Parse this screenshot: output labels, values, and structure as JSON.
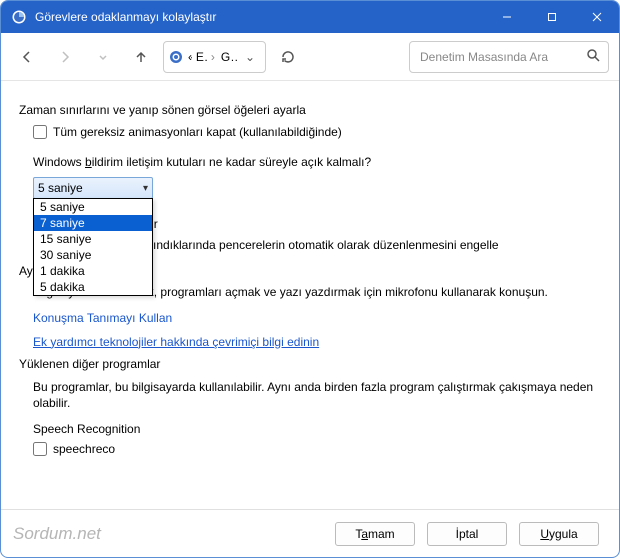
{
  "titlebar": {
    "title": "Görevlere odaklanmayı kolaylaştır"
  },
  "breadcrumb": {
    "root_label": "«",
    "crumb1": "Erişi...",
    "crumb2": "Görevle..."
  },
  "search": {
    "placeholder": "Denetim Masasında Ara"
  },
  "section1": {
    "heading": "Zaman sınırlarını ve yanıp sönen görsel öğeleri ayarla",
    "checkbox_label": "Tüm gereksiz animasyonları kapat (kullanılabildiğinde)",
    "sub_label_prefix": "Windows ",
    "sub_label_hot": "b",
    "sub_label_rest": "ildirim iletişim kutuları ne kadar süreyle açık kalmalı?",
    "selected": "5 saniye",
    "options": [
      "5 saniye",
      "7 saniye",
      "15 saniye",
      "30 saniye",
      "1 dakika",
      "5 dakika"
    ],
    "highlight_index": 1
  },
  "section2": {
    "heading_suffix": "laylaştır",
    "text_suffix": "ındıklarında pencerelerin otomatik olarak düzenlenmesini engelle"
  },
  "section3": {
    "heading_prefix": "Ayrı",
    "body": "Bilgisayarı denetlemek, programları açmak ve yazı yazdırmak için mikrofonu kullanarak konuşun.",
    "link1": "Konuşma Tanımayı Kullan",
    "link2": "Ek yardımcı teknolojiler hakkında çevrimiçi bilgi edinin"
  },
  "section4": {
    "heading": "Yüklenen diğer programlar",
    "body": "Bu programlar, bu bilgisayarda kullanılabilir. Aynı anda birden fazla program çalıştırmak çakışmaya neden olabilir.",
    "item_title": "Speech Recognition",
    "item_checkbox_label": "speechreco"
  },
  "buttons": {
    "ok_prefix": "T",
    "ok_hot": "a",
    "ok_suffix": "mam",
    "cancel": "İptal",
    "apply_hot": "U",
    "apply_suffix": "ygula"
  },
  "watermark": "Sordum.net"
}
